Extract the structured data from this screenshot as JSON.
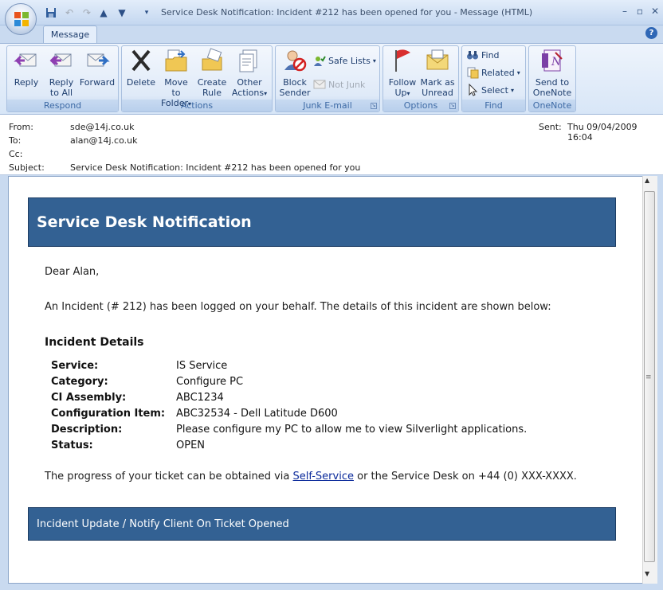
{
  "window": {
    "title": "Service Desk Notification: Incident #212 has been opened for you - Message (HTML)"
  },
  "ribbon": {
    "tab": "Message",
    "groups": {
      "respond": "Respond",
      "actions": "Actions",
      "junk": "Junk E-mail",
      "options": "Options",
      "find": "Find",
      "onenote": "OneNote"
    },
    "buttons": {
      "reply": "Reply",
      "reply_all_1": "Reply",
      "reply_all_2": "to All",
      "forward": "Forward",
      "delete": "Delete",
      "move_1": "Move to",
      "move_2": "Folder",
      "create_1": "Create",
      "create_2": "Rule",
      "other_1": "Other",
      "other_2": "Actions",
      "block_1": "Block",
      "block_2": "Sender",
      "safe_lists": "Safe Lists",
      "not_junk": "Not Junk",
      "follow_1": "Follow",
      "follow_2": "Up",
      "mark_1": "Mark as",
      "mark_2": "Unread",
      "find": "Find",
      "related": "Related",
      "select": "Select",
      "send_1": "Send to",
      "send_2": "OneNote"
    }
  },
  "header": {
    "from_label": "From:",
    "from": "sde@14j.co.uk",
    "to_label": "To:",
    "to": "alan@14j.co.uk",
    "cc_label": "Cc:",
    "subject_label": "Subject:",
    "subject": "Service Desk Notification: Incident #212 has been opened for you",
    "sent_label": "Sent:",
    "sent": "Thu 09/04/2009 16:04"
  },
  "email": {
    "banner_title": "Service Desk Notification",
    "greeting": "Dear Alan,",
    "intro": "An Incident (# 212) has been logged on your behalf. The details of this incident are shown below:",
    "details_heading": "Incident Details",
    "details": [
      {
        "label": "Service:",
        "value": "IS Service"
      },
      {
        "label": "Category:",
        "value": "Configure PC"
      },
      {
        "label": "CI Assembly:",
        "value": "ABC1234"
      },
      {
        "label": "Configuration Item:",
        "value": "ABC32534 - Dell Latitude D600"
      },
      {
        "label": "Description:",
        "value": "Please configure my PC to allow me to view Silverlight applications."
      },
      {
        "label": "Status:",
        "value": "OPEN"
      }
    ],
    "progress_before": "The progress of your ticket can be obtained via ",
    "progress_link": "Self-Service",
    "progress_after": " or the Service Desk on +44 (0) XXX-XXXX.",
    "footer": "Incident Update / Notify Client On Ticket Opened"
  }
}
